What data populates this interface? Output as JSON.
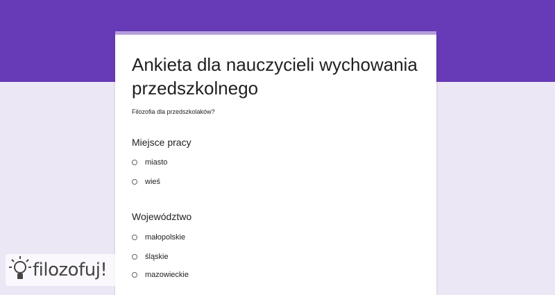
{
  "form": {
    "title": "Ankieta dla nauczycieli wychowania przedszkolnego",
    "description": "Filozofia dla przedszkolaków?"
  },
  "questions": [
    {
      "title": "Miejsce pracy",
      "options": [
        {
          "label": "miasto",
          "selected": false
        },
        {
          "label": "wieś",
          "selected": false
        }
      ]
    },
    {
      "title": "Województwo",
      "options": [
        {
          "label": "małopolskie",
          "selected": false
        },
        {
          "label": "śląskie",
          "selected": false
        },
        {
          "label": "mazowieckie",
          "selected": false
        }
      ]
    }
  ],
  "watermark": {
    "text": "filozofuj!",
    "icon": "lightbulb-icon"
  },
  "colors": {
    "header": "#673ab7",
    "background": "#ece7f4",
    "card_accent": "#b39ddb",
    "card": "#ffffff",
    "text": "#212121"
  }
}
